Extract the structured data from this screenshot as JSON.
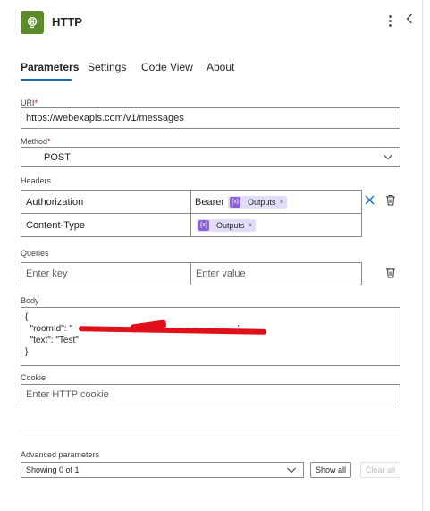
{
  "header": {
    "title": "HTTP",
    "more_icon": "more-vertical-icon",
    "collapse_icon": "chevron-left-icon",
    "action_icon": "globe-icon",
    "icon_color": "#5a8a2a"
  },
  "tabs": [
    {
      "label": "Parameters",
      "active": true
    },
    {
      "label": "Settings",
      "active": false
    },
    {
      "label": "Code View",
      "active": false
    },
    {
      "label": "About",
      "active": false
    }
  ],
  "uri": {
    "label": "URI",
    "required": "*",
    "value": "https://webexapis.com/v1/messages"
  },
  "method": {
    "label": "Method",
    "required": "*",
    "value": "POST"
  },
  "headers": {
    "label": "Headers",
    "rows": [
      {
        "key": "Authorization",
        "prefix": "Bearer",
        "token_label": "Outputs",
        "token_close": "×"
      },
      {
        "key": "Content-Type",
        "prefix": "",
        "token_label": "Outputs",
        "token_close": "×"
      }
    ],
    "token_icon_text": "{x}"
  },
  "queries": {
    "label": "Queries",
    "key_placeholder": "Enter key",
    "value_placeholder": "Enter value"
  },
  "body": {
    "label": "Body",
    "lines": [
      "{",
      "  \"roomId\": \"",
      "  \"text\": \"Test\"",
      "}"
    ],
    "line2_tail": "\","
  },
  "cookie": {
    "label": "Cookie",
    "placeholder": "Enter HTTP cookie"
  },
  "advanced": {
    "label": "Advanced parameters",
    "dropdown_value": "Showing 0 of 1",
    "show_all": "Show all",
    "clear_all": "Clear all"
  },
  "colors": {
    "accent": "#0f6cbd",
    "token_bg": "#e3dcf7",
    "token_icon": "#8b5fd5",
    "redaction": "#e0101a"
  }
}
